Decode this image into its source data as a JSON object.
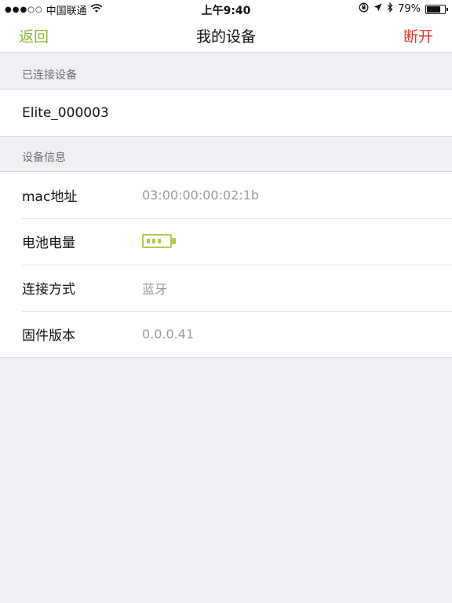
{
  "status_bar": {
    "signal": "●●●○○",
    "carrier": "中国联通",
    "wifi_icon": "wifi-icon",
    "time": "上午9:40",
    "battery_percent": "79%",
    "battery_level": 0.79
  },
  "nav": {
    "back_label": "返回",
    "title": "我的设备",
    "right_label": "断开"
  },
  "connected_section": {
    "header": "已连接设备",
    "device_name": "Elite_000003"
  },
  "info_section": {
    "header": "设备信息",
    "rows": [
      {
        "label": "mac地址",
        "value": "03:00:00:00:02:1b"
      },
      {
        "label": "电池电量",
        "value": ""
      },
      {
        "label": "连接方式",
        "value": "蓝牙"
      },
      {
        "label": "固件版本",
        "value": "0.0.0.41"
      }
    ],
    "battery_bars_shown": 3
  },
  "colors": {
    "accent_green": "#8ab72e",
    "danger_red": "#e23b2e",
    "battery_green": "#a9cc51",
    "background": "#efeff4"
  }
}
